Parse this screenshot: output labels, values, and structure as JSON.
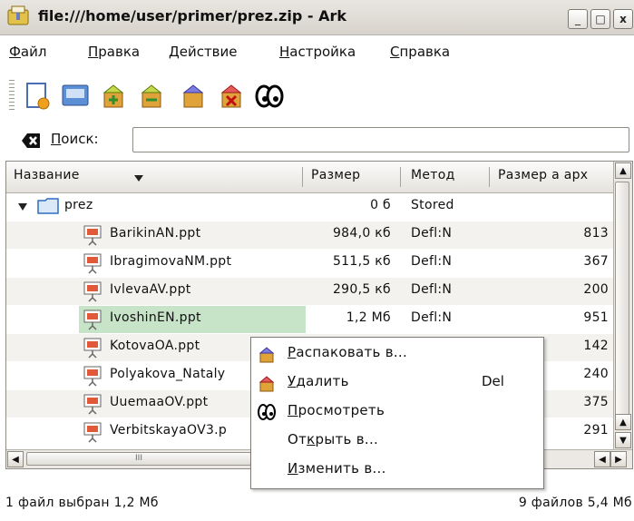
{
  "window": {
    "title": "file:///home/user/primer/prez.zip - Ark",
    "minimize_label": "_",
    "maximize_label": "□",
    "close_label": "x"
  },
  "menubar": {
    "items": [
      {
        "accel": "Ф",
        "rest": "айл"
      },
      {
        "accel": "П",
        "rest": "равка"
      },
      {
        "accel": "Д",
        "rest": "ействие"
      },
      {
        "accel": "Н",
        "rest": "астройка"
      },
      {
        "accel": "С",
        "rest": "правка"
      }
    ]
  },
  "toolbar": {
    "icons": [
      "new-archive-icon",
      "open-archive-icon",
      "extract-icon",
      "add-files-icon",
      "add-folder-icon",
      "delete-icon",
      "view-icon"
    ]
  },
  "search": {
    "accel": "П",
    "rest": "оиск:",
    "value": "",
    "placeholder": ""
  },
  "table": {
    "columns": [
      "Название",
      "Размер",
      "Метод",
      "Размер а арх"
    ],
    "folder": {
      "name": "prez",
      "size": "0 б",
      "method": "Stored",
      "packed": ""
    },
    "rows": [
      {
        "name": "BarikinAN.ppt",
        "size": "984,0 кб",
        "method": "Defl:N",
        "packed": "813"
      },
      {
        "name": "IbragimovaNM.ppt",
        "size": "511,5 кб",
        "method": "Defl:N",
        "packed": "367"
      },
      {
        "name": "IvlevaAV.ppt",
        "size": "290,5 кб",
        "method": "Defl:N",
        "packed": "200"
      },
      {
        "name": "IvoshinEN.ppt",
        "size": "1,2 Мб",
        "method": "Defl:N",
        "packed": "951"
      },
      {
        "name": "KotovaOA.ppt",
        "size": "",
        "method": "",
        "packed": "142"
      },
      {
        "name": "Polyakova_Nataly",
        "size": "",
        "method": "",
        "packed": "240"
      },
      {
        "name": "UuemaaOV.ppt",
        "size": "",
        "method": "",
        "packed": "375"
      },
      {
        "name": "VerbitskayaOV3.p",
        "size": "",
        "method": "",
        "packed": "291"
      }
    ],
    "hscroll_mark": "III"
  },
  "context_menu": {
    "items": [
      {
        "accel": "Р",
        "rest": "аспаковать в...",
        "shortcut": "",
        "icon": "extract-icon"
      },
      {
        "accel": "У",
        "rest": "далить",
        "shortcut": "Del",
        "icon": "delete-icon"
      },
      {
        "accel": "П",
        "rest": "росмотреть",
        "shortcut": "",
        "icon": "view-icon"
      },
      {
        "pre": "От",
        "accel": "к",
        "rest": "рыть в...",
        "shortcut": "",
        "icon": ""
      },
      {
        "accel": "И",
        "rest": "зменить в...",
        "shortcut": "",
        "icon": ""
      }
    ]
  },
  "status": {
    "left": "1 файл выбран 1,2 Мб",
    "right": "9 файлов 5,4 Мб"
  }
}
